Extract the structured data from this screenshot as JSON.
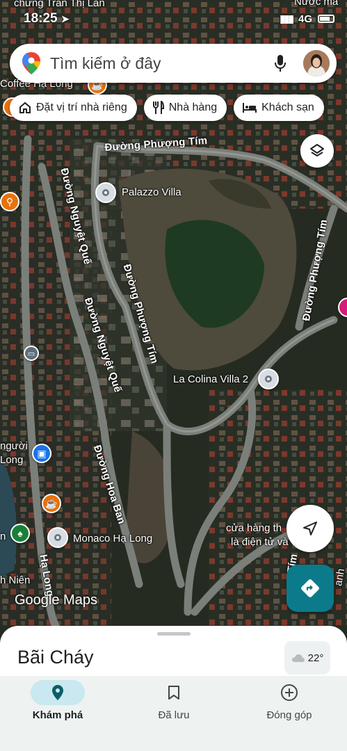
{
  "status": {
    "time": "18:25",
    "notification_text": "chứng Trần Thị Lan",
    "network": "4G",
    "top_right_text": "Nước ma"
  },
  "search": {
    "placeholder": "Tìm kiếm ở đây"
  },
  "chips": [
    {
      "label": "Đặt vị trí nhà riêng",
      "icon": "home-icon"
    },
    {
      "label": "Nhà hàng",
      "icon": "restaurant-icon"
    },
    {
      "label": "Khách sạn",
      "icon": "hotel-icon"
    }
  ],
  "map": {
    "roads": {
      "phuong_tim_top": "Đường Phượng Tím",
      "nguyet_que_1": "Đường Nguyệt Quế",
      "phuong_tim_mid": "Đường Phượng Tím",
      "nguyet_que_2": "Đường Nguyệt Quế",
      "phuong_tim_right": "Đường Phượng Tím",
      "hoa_ban": "Đường Hoa Ban",
      "ha_long": "Hạ Long",
      "right_road": "Tím"
    },
    "places": {
      "palazzo": "Palazzo Villa",
      "colina": "La Colina Villa 2",
      "monaco": "Monaco Hạ Long",
      "coffee": "Coffee Hạ Long",
      "nguoi_long_1": "người",
      "nguoi_long_2": "Long",
      "store_1": "cửa hàng th",
      "store_2": "là điện tử và",
      "n_label": "n",
      "thanh_nien": "h Niên",
      "anh": "anh"
    },
    "logo_text": "Google Maps"
  },
  "sheet": {
    "title": "Bãi Cháy",
    "weather": "22°"
  },
  "nav": [
    {
      "label": "Khám phá",
      "icon": "explore-pin-icon",
      "active": true
    },
    {
      "label": "Đã lưu",
      "icon": "bookmark-icon",
      "active": false
    },
    {
      "label": "Đóng góp",
      "icon": "add-circle-icon",
      "active": false
    }
  ],
  "colors": {
    "accent_teal": "#0b7a8a",
    "nav_active_pill": "#c9e8ef"
  }
}
